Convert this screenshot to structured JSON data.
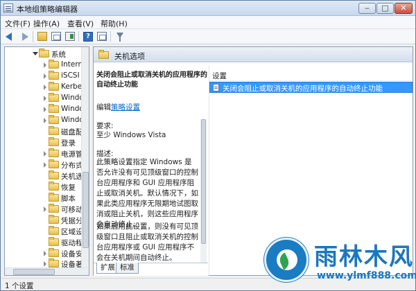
{
  "window": {
    "title": "本地组策略编辑器",
    "minimize": "‒",
    "maximize": "□",
    "close": "✕"
  },
  "menu": [
    "文件(F)",
    "操作(A)",
    "查看(V)",
    "帮助(H)"
  ],
  "toolbar": {
    "help_glyph": "?",
    "icons": [
      "back-icon",
      "forward-icon",
      "up-folder-icon",
      "show-hide-tree-icon",
      "export-list-icon",
      "help-icon",
      "properties-icon",
      "filter-icon"
    ]
  },
  "tree": {
    "items": [
      {
        "label": "系统",
        "expanded": true
      },
      {
        "label": "Intern"
      },
      {
        "label": "iSCSI"
      },
      {
        "label": "Kerbe"
      },
      {
        "label": "Windo"
      },
      {
        "label": "Windo"
      },
      {
        "label": "Windo"
      },
      {
        "label": "磁盘配"
      },
      {
        "label": "登录"
      },
      {
        "label": "电源管"
      },
      {
        "label": "分布式"
      },
      {
        "label": "关机选"
      },
      {
        "label": "恢复"
      },
      {
        "label": "脚本"
      },
      {
        "label": "可移动"
      },
      {
        "label": "凭据分"
      },
      {
        "label": "区域设"
      },
      {
        "label": "驱动程"
      },
      {
        "label": "设备安"
      },
      {
        "label": "设备著"
      }
    ]
  },
  "pane": {
    "title": "关机选项"
  },
  "description": {
    "title": "关闭会阻止或取消关机的应用程序的自动终止功能",
    "edit_prefix": "编辑",
    "edit_link": "策略设置",
    "requirements_label": "要求:",
    "requirements": "至少 Windows Vista",
    "desc_label": "描述:",
    "body1": "此策略设置指定 Windows 是否允许没有可见顶级窗口的控制台应用程序和 GUI 应用程序阻止或取消关机。默认情况下，如果此类应用程序无限期地试图取消或阻止关机，则这些应用程序会自动终止。",
    "body2": "如果启用此设置，则没有可见顶级窗口且阻止或取消关机的控制台应用程序或 GUI 应用程序不会在关机期间自动终止。"
  },
  "list": {
    "header": "设置",
    "rows": [
      "关闭会阻止或取消关机的应用程序的自动终止功能"
    ]
  },
  "tabs": [
    "扩展",
    "标准"
  ],
  "status": {
    "text": "1 个设置"
  },
  "watermark": {
    "title": "雨林木风",
    "url": "www.ylmf888.com"
  },
  "colors": {
    "selection": "#3399ff",
    "link": "#0066cc",
    "watermark": "#1b77bd"
  }
}
